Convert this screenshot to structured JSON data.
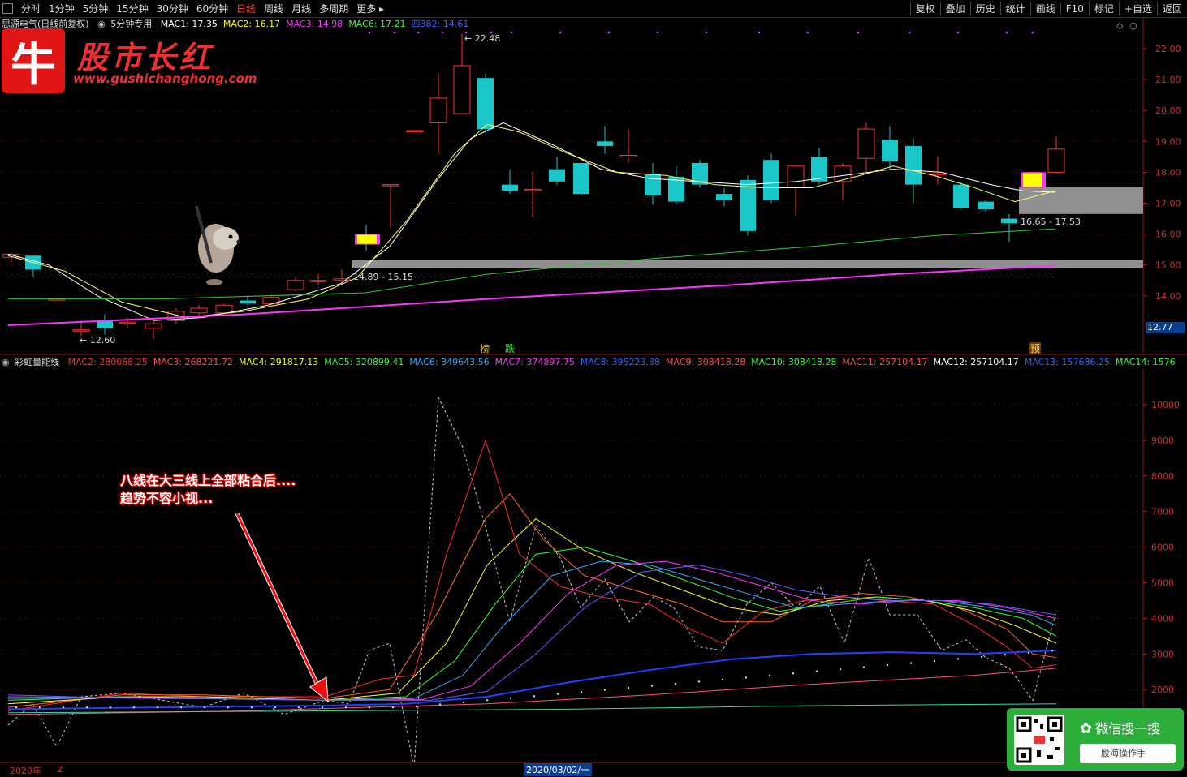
{
  "toolbar": {
    "periods": [
      "分时",
      "1分钟",
      "5分钟",
      "15分钟",
      "30分钟",
      "60分钟",
      "日线",
      "周线",
      "月线",
      "多周期",
      "更多"
    ],
    "active_period": "日线",
    "right_buttons": [
      "复权",
      "叠加",
      "历史",
      "统计",
      "画线",
      "F10",
      "标记",
      "+自选",
      "返回"
    ]
  },
  "main": {
    "stock_label": "思源电气(日线前复权)",
    "indicator_switch": "5分钟专用",
    "ma": [
      {
        "label": "MAC1: 17.35",
        "color": "#ffffff"
      },
      {
        "label": "MAC2: 16.17",
        "color": "#ffff00"
      },
      {
        "label": "MAC3: 14.98",
        "color": "#ff33ff"
      },
      {
        "label": "MAC6: 17.21",
        "color": "#33ff33"
      },
      {
        "label": "四382: 14.61",
        "color": "#3a5fff"
      }
    ],
    "price_axis": [
      "22.00",
      "21.00",
      "20.00",
      "19.00",
      "18.00",
      "17.00",
      "16.00",
      "15.00",
      "14.00"
    ],
    "current_price_box": "12.77",
    "annotations": {
      "high": "22.48",
      "low": "12.60",
      "zone1": "14.89 - 15.15",
      "zone2": "16.65 - 17.53"
    },
    "markers": {
      "bang": "榜",
      "die": "跌",
      "yu": "预"
    }
  },
  "indicator": {
    "name": "彩虹量能线",
    "lines": [
      {
        "label": "MAC2: 280068.25",
        "color": "#ff3333"
      },
      {
        "label": "MAC3: 268221.72",
        "color": "#ff5050"
      },
      {
        "label": "MAC4: 291817.13",
        "color": "#ffff00"
      },
      {
        "label": "MAC5: 320899.41",
        "color": "#33ff33"
      },
      {
        "label": "MAC6: 349643.56",
        "color": "#33aaff"
      },
      {
        "label": "MAC7: 374897.75",
        "color": "#ff33ff"
      },
      {
        "label": "MAC8: 395223.38",
        "color": "#3a5fff"
      },
      {
        "label": "MAC9: 308418.28",
        "color": "#ff5050"
      },
      {
        "label": "MAC10: 308418.28",
        "color": "#33ff33"
      },
      {
        "label": "MAC11: 257104.17",
        "color": "#ff5050"
      },
      {
        "label": "MAC12: 257104.17",
        "color": "#ffffff"
      },
      {
        "label": "MAC13: 157686.25",
        "color": "#3a5fff"
      },
      {
        "label": "MAC14: 1576",
        "color": "#33ff33"
      }
    ],
    "axis": [
      "10000",
      "9000",
      "8000",
      "7000",
      "6000",
      "5000",
      "4000",
      "3000",
      "2000"
    ]
  },
  "logo": {
    "icon_char": "牛",
    "title": "股市长红",
    "url": "www.gushichanghong.com"
  },
  "annotation_text": [
    "八线在大三线上全部粘合后....",
    "趋势不容小视..."
  ],
  "wechat": {
    "title": "微信搜一搜",
    "search": "股海操作手"
  },
  "bottom": {
    "year": "2020年",
    "num": "2",
    "date": "2020/03/02/一"
  }
}
